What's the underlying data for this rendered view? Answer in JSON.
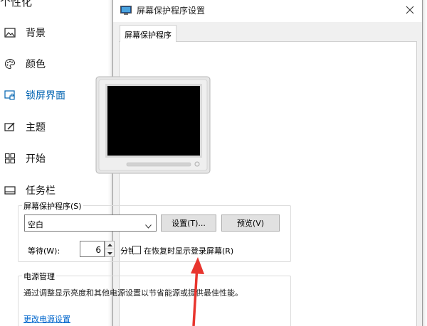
{
  "settings_nav": {
    "title": "个性化",
    "items": [
      {
        "label": "背景",
        "icon": "image-icon"
      },
      {
        "label": "颜色",
        "icon": "palette-icon"
      },
      {
        "label": "锁屏界面",
        "icon": "lock-screen-icon"
      },
      {
        "label": "主题",
        "icon": "theme-icon"
      },
      {
        "label": "开始",
        "icon": "start-icon"
      },
      {
        "label": "任务栏",
        "icon": "taskbar-icon"
      }
    ],
    "active_index": 2,
    "accent_color": "#0063b1"
  },
  "dialog": {
    "title": "屏幕保护程序设置",
    "tab_label": "屏幕保护程序",
    "screensaver_group": {
      "label": "屏幕保护程序(S)",
      "selected_value": "空白",
      "settings_button": "设置(T)...",
      "preview_button": "预览(V)",
      "wait_label": "等待(W):",
      "wait_value": "6",
      "minutes_label": "分钟",
      "resume_checkbox_label": "在恢复时显示登录屏幕(R)",
      "resume_checked": false
    },
    "power_group": {
      "label": "电源管理",
      "description": "通过调整显示亮度和其他电源设置以节省能源或提供最佳性能。",
      "link": "更改电源设置"
    }
  },
  "annotation": {
    "arrow_color": "#e8352e"
  }
}
